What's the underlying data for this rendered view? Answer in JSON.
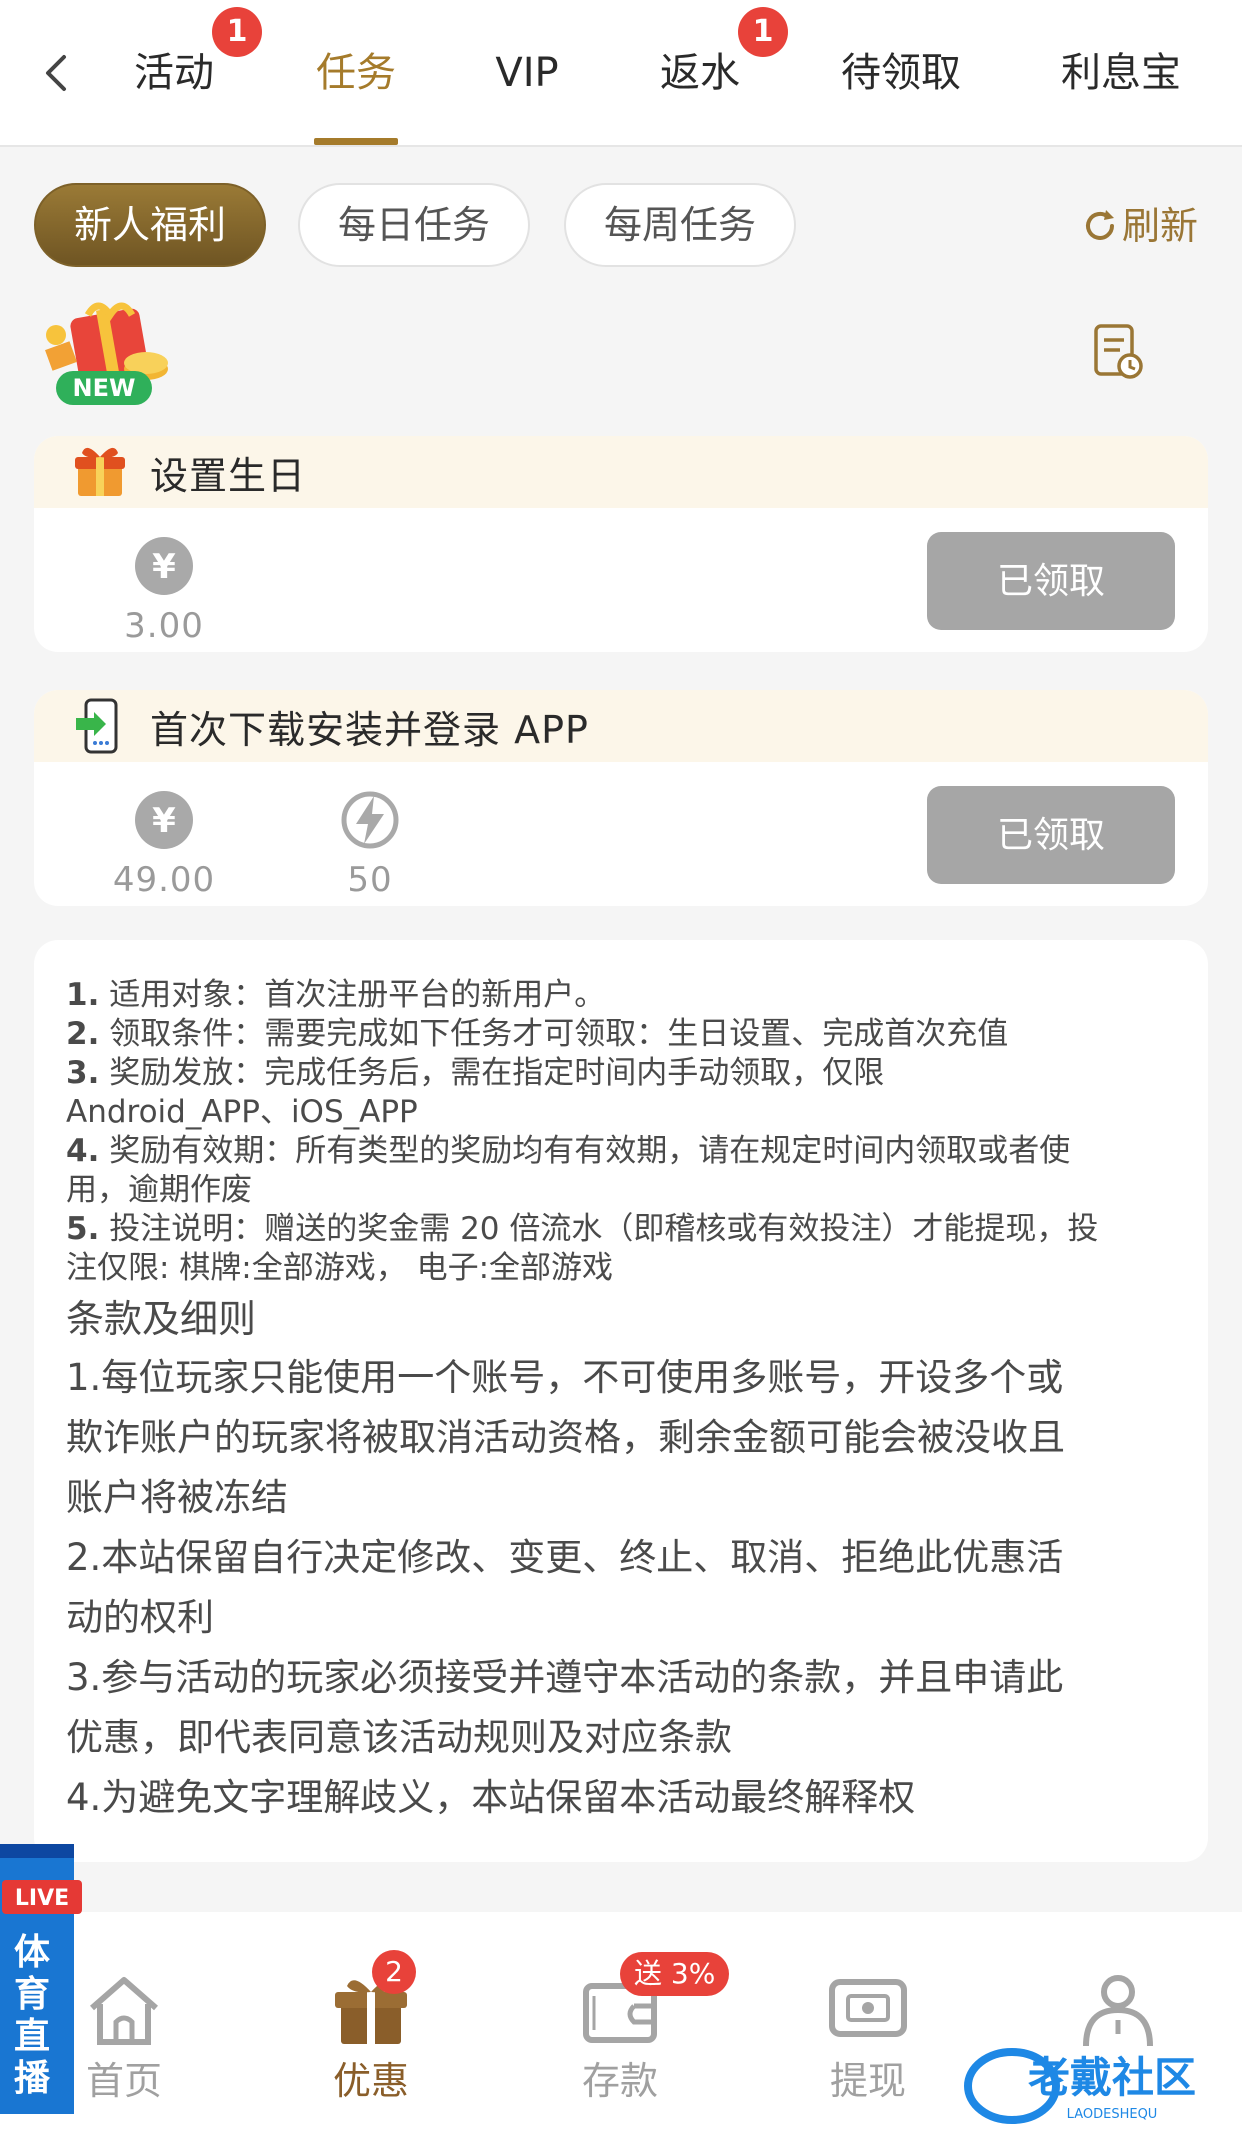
{
  "header": {
    "tabs": [
      {
        "label": "活动",
        "badge": "1"
      },
      {
        "label": "任务",
        "badge": ""
      },
      {
        "label": "VIP",
        "badge": ""
      },
      {
        "label": "返水",
        "badge": "1"
      },
      {
        "label": "待领取",
        "badge": ""
      },
      {
        "label": "利息宝",
        "badge": ""
      }
    ],
    "active_tab": "任务"
  },
  "subtabs": [
    {
      "label": "新人福利"
    },
    {
      "label": "每日任务"
    },
    {
      "label": "每周任务"
    }
  ],
  "refresh_label": "刷新",
  "new_badge": "NEW",
  "tasks": [
    {
      "title": "设置生日",
      "rewards": [
        {
          "icon": "yuan-coin-icon",
          "value": "3.00"
        }
      ],
      "button": "已领取"
    },
    {
      "title": "首次下载安装并登录 APP",
      "rewards": [
        {
          "icon": "yuan-coin-icon",
          "value": "49.00"
        },
        {
          "icon": "lightning-icon",
          "value": "50"
        }
      ],
      "button": "已领取"
    }
  ],
  "rules": {
    "items": [
      {
        "num": "1.",
        "text": " 适用对象：首次注册平台的新用户。"
      },
      {
        "num": "2.",
        "text": " 领取条件：需要完成如下任务才可领取：生日设置、完成首次充值"
      },
      {
        "num": "3.",
        "text": " 奖励发放：完成任务后，需在指定时间内手动领取，仅限"
      },
      {
        "num": "",
        "text": "Android_APP、iOS_APP"
      },
      {
        "num": "4.",
        "text": " 奖励有效期：所有类型的奖励均有有效期，请在规定时间内领取或者使"
      },
      {
        "num": "",
        "text": "用，逾期作废"
      },
      {
        "num": "5.",
        "text": " 投注说明：赠送的奖金需 20 倍流水（即稽核或有效投注）才能提现，投"
      },
      {
        "num": "",
        "text": "注仅限: 棋牌:全部游戏， 电子:全部游戏"
      }
    ],
    "terms_title": "条款及细则",
    "terms": [
      "1.每位玩家只能使用一个账号，不可使用多账号，开设多个或",
      "欺诈账户的玩家将被取消活动资格，剩余金额可能会被没收且",
      "账户将被冻结",
      "2.本站保留自行决定修改、变更、终止、取消、拒绝此优惠活",
      "动的权利",
      "3.参与活动的玩家必须接受并遵守本活动的条款，并且申请此",
      "优惠，即代表同意该活动规则及对应条款",
      "4.为避免文字理解歧义，本站保留本活动最终解释权"
    ]
  },
  "bottom_nav": [
    {
      "label": "首页",
      "icon": "home-icon",
      "badge": ""
    },
    {
      "label": "优惠",
      "icon": "gift-icon",
      "badge": "2"
    },
    {
      "label": "存款",
      "icon": "wallet-icon",
      "badge": "送 3%"
    },
    {
      "label": "提现",
      "icon": "cash-icon",
      "badge": ""
    },
    {
      "label": "",
      "icon": "user-icon",
      "badge": ""
    }
  ],
  "live_float": {
    "tag": "LIVE",
    "text": [
      "体",
      "育",
      "直",
      "播"
    ]
  },
  "watermark": {
    "text": "老戴社区",
    "sub": "LAODESHEQU"
  },
  "colors": {
    "accent": "#a57b2b",
    "badge": "#e8423a",
    "claimed_button": "#a6a6a6"
  }
}
